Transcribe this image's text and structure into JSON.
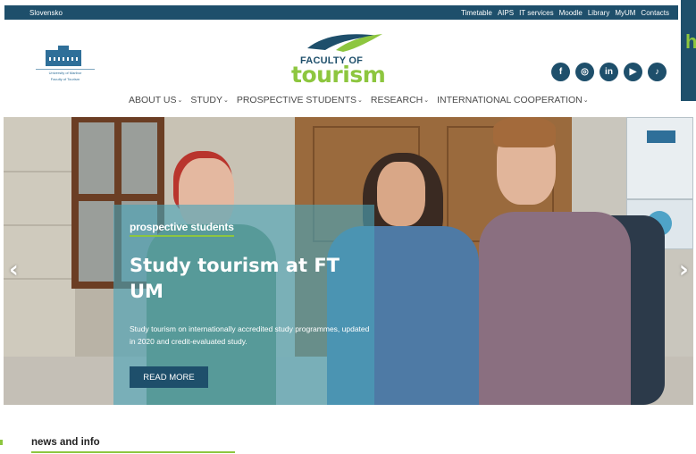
{
  "topbar": {
    "language": "Slovensko",
    "links": [
      "Timetable",
      "AIPS",
      "IT services",
      "Moodle",
      "Library",
      "MyUM",
      "Contacts"
    ]
  },
  "edge_panel": {
    "text": "h"
  },
  "header": {
    "um_logo": {
      "line1": "University of Maribor",
      "line2": "Faculty of Tourism"
    },
    "ft_logo": {
      "line1": "FACULTY OF",
      "line2": "tourism"
    },
    "social": [
      {
        "icon": "facebook-icon",
        "glyph": "f"
      },
      {
        "icon": "instagram-icon",
        "glyph": "◎"
      },
      {
        "icon": "linkedin-icon",
        "glyph": "in"
      },
      {
        "icon": "youtube-icon",
        "glyph": "▶"
      },
      {
        "icon": "tiktok-icon",
        "glyph": "♪"
      }
    ]
  },
  "nav": {
    "items": [
      {
        "label": "ABOUT US",
        "chevron": "⌄"
      },
      {
        "label": "STUDY",
        "chevron": "⌄"
      },
      {
        "label": "PROSPECTIVE STUDENTS",
        "chevron": "⌄"
      },
      {
        "label": "RESEARCH",
        "chevron": "⌄"
      },
      {
        "label": "INTERNATIONAL COOPERATION",
        "chevron": "⌄"
      }
    ]
  },
  "hero": {
    "tag": "prospective students",
    "title": "Study tourism at FT UM",
    "description": "Study tourism on internationally accredited study programmes, updated in 2020 and credit-evaluated study.",
    "button": "READ MORE",
    "prev_arrow": "‹",
    "next_arrow": "›"
  },
  "news": {
    "title": "news and info"
  },
  "colors": {
    "primary": "#1e4f6b",
    "accent": "#8dc63f",
    "overlay": "#4aa4ba"
  }
}
